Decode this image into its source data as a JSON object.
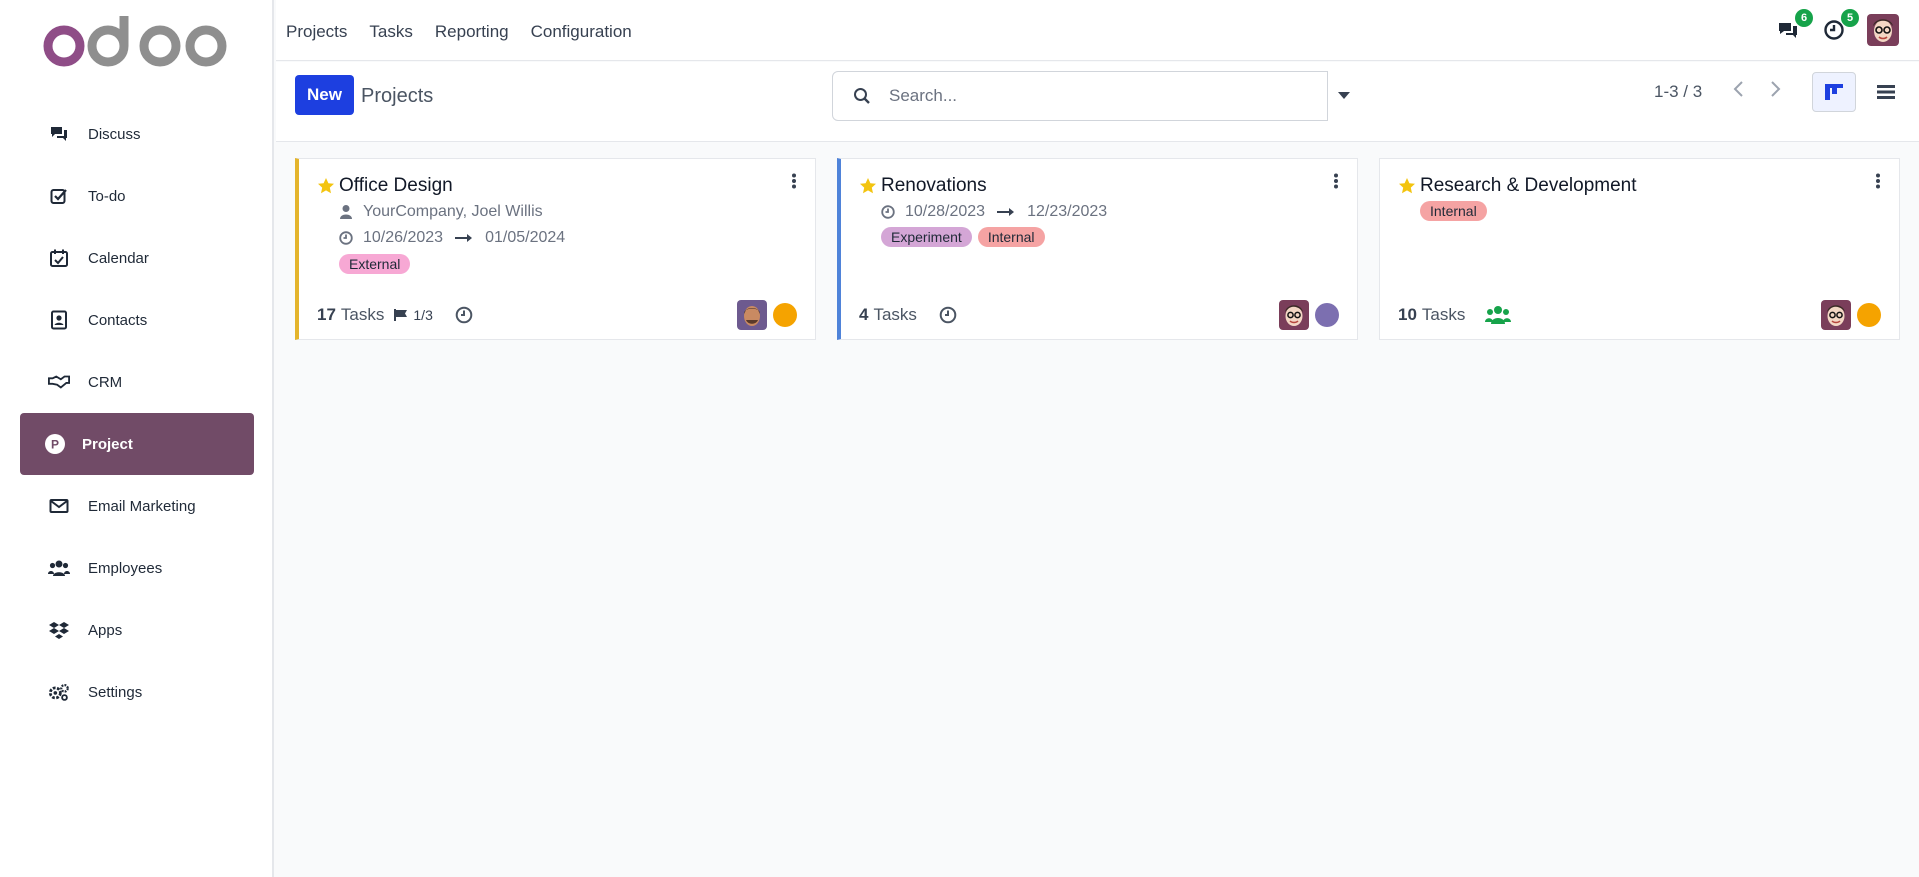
{
  "brand": {
    "logo_text": "odoo"
  },
  "sidebar": {
    "items": [
      {
        "label": "Discuss",
        "icon": "chat-icon"
      },
      {
        "label": "To-do",
        "icon": "checkbox-icon"
      },
      {
        "label": "Calendar",
        "icon": "calendar-icon"
      },
      {
        "label": "Contacts",
        "icon": "contacts-icon"
      },
      {
        "label": "CRM",
        "icon": "handshake-icon"
      },
      {
        "label": "Project",
        "icon": "project-icon",
        "active": true
      },
      {
        "label": "Email Marketing",
        "icon": "envelope-icon"
      },
      {
        "label": "Employees",
        "icon": "users-icon"
      },
      {
        "label": "Apps",
        "icon": "apps-icon"
      },
      {
        "label": "Settings",
        "icon": "gears-icon"
      }
    ]
  },
  "topbar": {
    "menu": [
      "Projects",
      "Tasks",
      "Reporting",
      "Configuration"
    ],
    "messages_count": "6",
    "activities_count": "5"
  },
  "control": {
    "new_label": "New",
    "breadcrumb": "Projects",
    "search_placeholder": "Search...",
    "pager": "1-3 / 3"
  },
  "projects": [
    {
      "title": "Office Design",
      "customer": "YourCompany, Joel Willis",
      "date_start": "10/26/2023",
      "date_end": "01/05/2024",
      "tags": [
        "External"
      ],
      "tasks": "17",
      "tasks_label": "Tasks",
      "milestones": "1/3",
      "color": "#e4b42c",
      "dot_color": "#f5a300"
    },
    {
      "title": "Renovations",
      "date_start": "10/28/2023",
      "date_end": "12/23/2023",
      "tags": [
        "Experiment",
        "Internal"
      ],
      "tasks": "4",
      "tasks_label": "Tasks",
      "color": "#4f83d9",
      "dot_color": "#7c6fb0"
    },
    {
      "title": "Research & Development",
      "tags": [
        "Internal"
      ],
      "tasks": "10",
      "tasks_label": "Tasks",
      "dot_color": "#f5a300"
    }
  ]
}
